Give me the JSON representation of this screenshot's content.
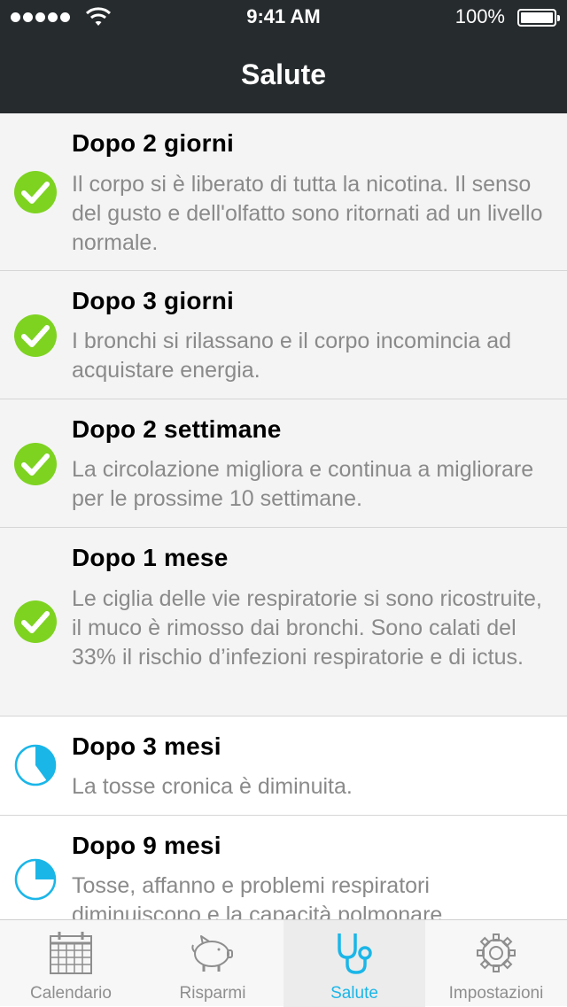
{
  "status_bar": {
    "time": "9:41 AM",
    "battery": "100%"
  },
  "header": {
    "title": "Salute"
  },
  "colors": {
    "done": "#7ed321",
    "pending": "#1bb6e8",
    "header_bg": "#262b2d"
  },
  "items": [
    {
      "title": "Dopo 2 giorni",
      "description": "Il corpo si è liberato di tutta la nicotina. Il senso del gusto e dell'olfatto sono ritornati ad un livello normale.",
      "status": "done",
      "icon": "checkmark-icon"
    },
    {
      "title": "Dopo 3 giorni",
      "description": "I bronchi si rilassano e il corpo incomincia ad acquistare energia.",
      "status": "done",
      "icon": "checkmark-icon"
    },
    {
      "title": "Dopo 2 settimane",
      "description": "La circolazione migliora e continua a migliorare per le prossime 10 settimane.",
      "status": "done",
      "icon": "checkmark-icon"
    },
    {
      "title": "Dopo 1 mese",
      "description": "Le ciglia delle vie respiratorie si sono ricostruite, il muco è rimosso dai bronchi. Sono calati del 33% il rischio d’infezioni respiratorie e di ictus.",
      "status": "done",
      "icon": "checkmark-icon"
    },
    {
      "title": "Dopo 3 mesi",
      "description": "La tosse cronica è diminuita.",
      "status": "in-progress",
      "progress": 0.4,
      "icon": "progress-pie-icon"
    },
    {
      "title": "Dopo 9 mesi",
      "description": "Tosse, affanno e problemi respiratori diminuiscono e la capacità polmonare",
      "status": "in-progress",
      "progress": 0.25,
      "icon": "progress-pie-icon"
    }
  ],
  "tabs": [
    {
      "label": "Calendario",
      "icon": "calendar-icon",
      "active": false
    },
    {
      "label": "Risparmi",
      "icon": "piggy-bank-icon",
      "active": false
    },
    {
      "label": "Salute",
      "icon": "stethoscope-icon",
      "active": true
    },
    {
      "label": "Impostazioni",
      "icon": "gear-icon",
      "active": false
    }
  ]
}
